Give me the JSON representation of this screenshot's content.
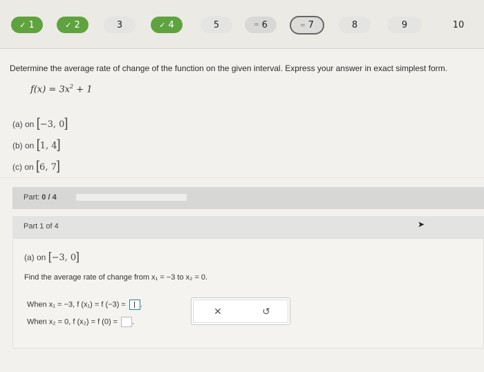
{
  "nav": {
    "questions": [
      {
        "label": "1",
        "state": "done"
      },
      {
        "label": "2",
        "state": "done"
      },
      {
        "label": "3",
        "state": "todo"
      },
      {
        "label": "4",
        "state": "done"
      },
      {
        "label": "5",
        "state": "todo"
      },
      {
        "label": "6",
        "state": "partial"
      },
      {
        "label": "7",
        "state": "current"
      },
      {
        "label": "8",
        "state": "todo"
      },
      {
        "label": "9",
        "state": "todo"
      },
      {
        "label": "10",
        "state": "todo"
      }
    ]
  },
  "problem": {
    "instruction": "Determine the average rate of change of the function on the given interval. Express your answer in exact simplest form.",
    "function_lhs": "f(x) = 3x",
    "function_exp": "2",
    "function_rhs": " + 1",
    "intervals": [
      {
        "label": "(a) on",
        "open": "[",
        "math": "−3, 0",
        "close": "]"
      },
      {
        "label": "(b) on",
        "open": "[",
        "math": "1, 4",
        "close": "]"
      },
      {
        "label": "(c) on",
        "open": "[",
        "math": "6, 7",
        "close": "]"
      }
    ]
  },
  "progress": {
    "label": "Part:",
    "value": "0 / 4",
    "fraction": 0
  },
  "part": {
    "header": "Part 1 of 4",
    "sub_label": "(a) on",
    "sub_open": "[",
    "sub_math": "−3, 0",
    "sub_close": "]",
    "find_text": "Find the average rate of change from x₁ = −3 to x₂ = 0.",
    "line1": "When x₁ = −3, f (x₁) = f (−3) =",
    "line2": "When x₂ = 0, f (x₂) = f (0) ="
  },
  "tools": {
    "clear_glyph": "✕",
    "undo_glyph": "↺"
  },
  "colors": {
    "done": "#5fa33e",
    "accent": "#2a7e8e"
  }
}
